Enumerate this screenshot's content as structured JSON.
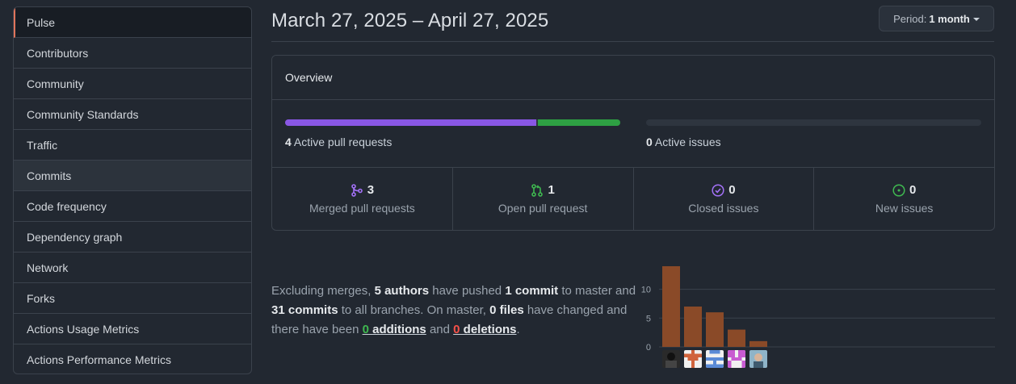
{
  "sidebar": {
    "items": [
      {
        "label": "Pulse"
      },
      {
        "label": "Contributors"
      },
      {
        "label": "Community"
      },
      {
        "label": "Community Standards"
      },
      {
        "label": "Traffic"
      },
      {
        "label": "Commits"
      },
      {
        "label": "Code frequency"
      },
      {
        "label": "Dependency graph"
      },
      {
        "label": "Network"
      },
      {
        "label": "Forks"
      },
      {
        "label": "Actions Usage Metrics"
      },
      {
        "label": "Actions Performance Metrics"
      }
    ]
  },
  "header": {
    "date_range": "March 27, 2025 – April 27, 2025",
    "period_label": "Period:",
    "period_value": "1 month"
  },
  "overview": {
    "title": "Overview",
    "active_prs_count": "4",
    "active_prs_label": "Active pull requests",
    "active_issues_count": "0",
    "active_issues_label": "Active issues",
    "pr_bar": {
      "merged_fraction": 0.75,
      "open_fraction": 0.25
    },
    "stats": [
      {
        "icon": "merge-icon",
        "count": "3",
        "label": "Merged pull requests",
        "color": "#a371f7"
      },
      {
        "icon": "pull-request-icon",
        "count": "1",
        "label": "Open pull request",
        "color": "#3fb950"
      },
      {
        "icon": "issue-closed-icon",
        "count": "0",
        "label": "Closed issues",
        "color": "#a371f7"
      },
      {
        "icon": "issue-opened-icon",
        "count": "0",
        "label": "New issues",
        "color": "#3fb950"
      }
    ]
  },
  "summary": {
    "t1": "Excluding merges, ",
    "authors": "5 authors",
    "t2": " have pushed ",
    "commit": "1 commit",
    "t3": " to master and ",
    "commits_all": "31 commits",
    "t4": " to all branches. On master, ",
    "files": "0 files",
    "t5": " have changed and there have been ",
    "additions_num": "0",
    "additions_word": " additions",
    "and": " and ",
    "deletions_num": "0",
    "deletions_word": " deletions",
    "end": "."
  },
  "chart_data": {
    "type": "bar",
    "categories": [
      "author-1",
      "author-2",
      "author-3",
      "author-4",
      "author-5"
    ],
    "values": [
      14,
      7,
      6,
      3,
      1
    ],
    "yticks": [
      0,
      5,
      10
    ],
    "ylim": [
      0,
      14
    ],
    "bar_color": "#8a4a28",
    "grid": true
  }
}
